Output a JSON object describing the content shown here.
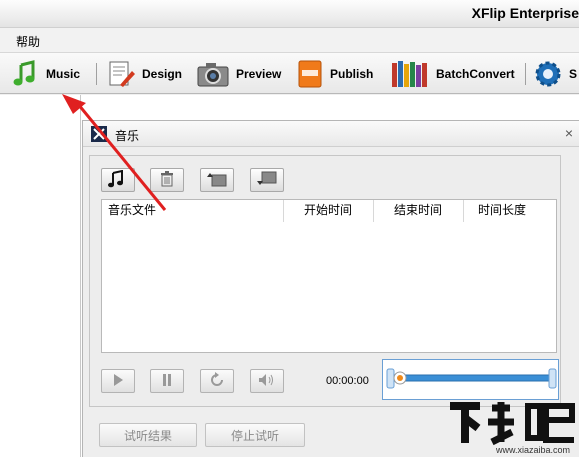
{
  "window": {
    "title": "XFlip Enterprise"
  },
  "menu": {
    "items": [
      {
        "label": "帮助"
      }
    ]
  },
  "toolbar": {
    "buttons": [
      {
        "label": "Music",
        "icon": "music-note-icon"
      },
      {
        "label": "Design",
        "icon": "design-pen-icon"
      },
      {
        "label": "Preview",
        "icon": "camera-icon"
      },
      {
        "label": "Publish",
        "icon": "book-icon"
      },
      {
        "label": "BatchConvert",
        "icon": "books-icon"
      },
      {
        "label": "S",
        "icon": "gear-icon"
      }
    ]
  },
  "dialog": {
    "title": "音乐",
    "close": "×",
    "toolbar_icons": [
      "add-music-icon",
      "trash-icon",
      "move-up-icon",
      "move-down-icon"
    ],
    "table": {
      "columns": [
        "音乐文件",
        "开始时间",
        "结束时间",
        "时间长度"
      ],
      "rows": []
    },
    "controls": [
      "play-icon",
      "pause-icon",
      "loop-icon",
      "volume-icon"
    ],
    "time": "00:00:00",
    "buttons": {
      "listen_result": "试听结果",
      "stop_listen": "停止试听"
    }
  },
  "watermark": {
    "text": "www.xiazaiba.com"
  },
  "colors": {
    "accent": "#2e7ec8",
    "arrow": "#e02020",
    "slider_track": "#3a8fd6"
  }
}
